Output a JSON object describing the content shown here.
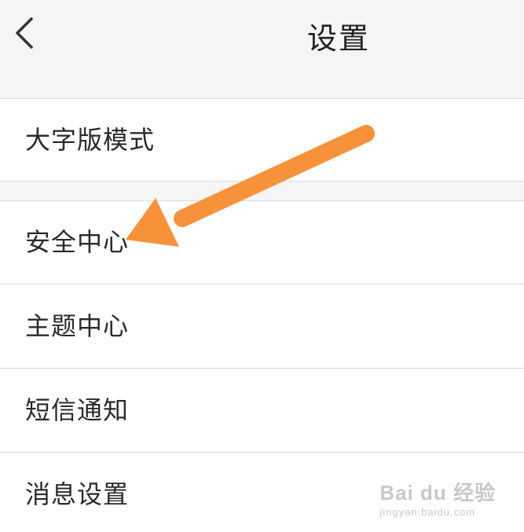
{
  "header": {
    "title": "设置"
  },
  "sections": [
    {
      "items": [
        {
          "label": "大字版模式"
        }
      ]
    },
    {
      "items": [
        {
          "label": "安全中心"
        },
        {
          "label": "主题中心"
        },
        {
          "label": "短信通知"
        },
        {
          "label": "消息设置"
        }
      ]
    }
  ],
  "annotation": {
    "arrow_color": "#f7923a"
  },
  "watermark": {
    "brand": "Bai du 经验",
    "url": "jingyan.baidu.com"
  },
  "colors": {
    "background": "#f5f5f5",
    "row": "#ffffff",
    "divider": "#dcdcdc",
    "text": "#2a2a2a"
  }
}
